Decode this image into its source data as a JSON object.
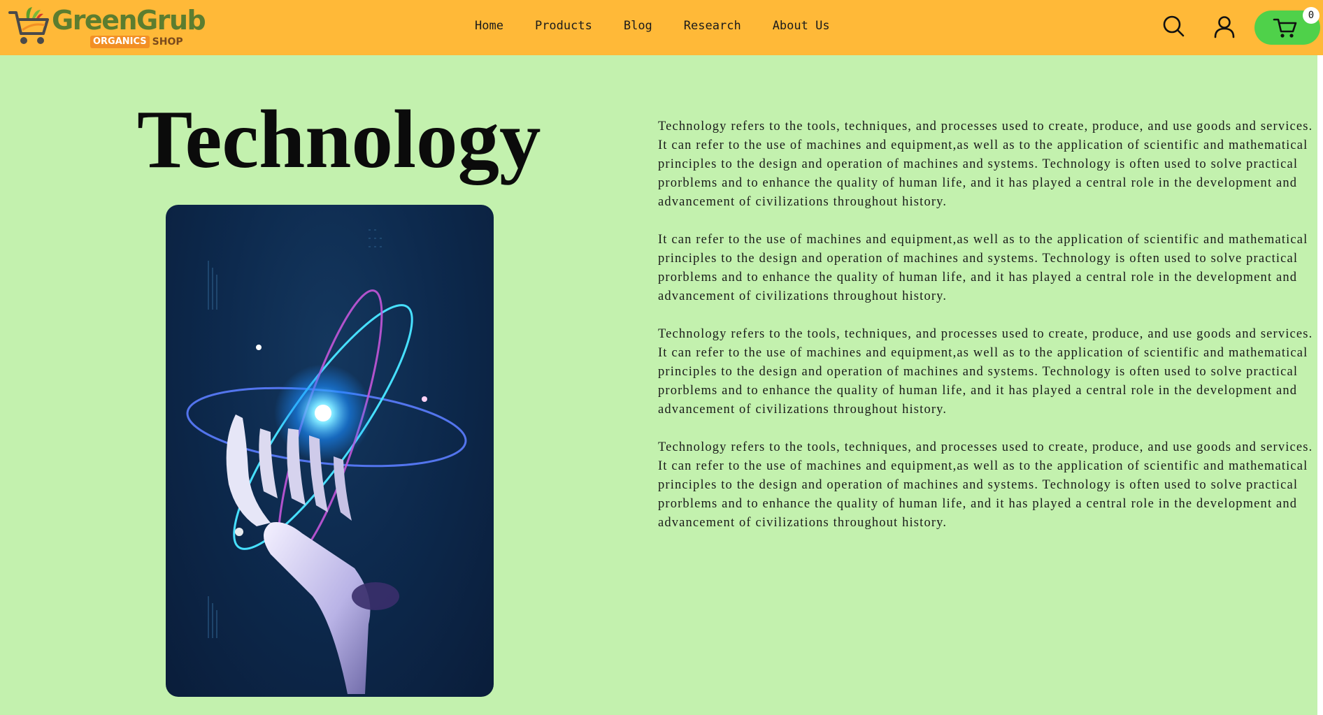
{
  "brand": {
    "name_part1": "Green",
    "name_part2": "Grub",
    "tag_organics": "ORGANICS",
    "tag_shop": "SHOP"
  },
  "nav": {
    "items": [
      {
        "label": "Home"
      },
      {
        "label": "Products"
      },
      {
        "label": "Blog"
      },
      {
        "label": "Research"
      },
      {
        "label": "About Us"
      }
    ]
  },
  "header_icons": {
    "search": "search-icon",
    "account": "user-icon",
    "cart": "cart-icon"
  },
  "cart": {
    "count": "0"
  },
  "page": {
    "title": "Technology"
  },
  "hero_image": {
    "subject": "robot-hand-atom-icon"
  },
  "article": {
    "paragraphs": [
      "Technology refers to the tools, techniques, and processes used to create, produce, and use goods and services. It can refer to the use of machines and equipment,as well as to the application of scientific and mathematical principles to the design and operation of machines and systems. Technology is often used to solve practical prorblems and to enhance the quality of human life, and it has played a central role in the development and advancement of civilizations throughout history.",
      "It can refer to the use of machines and equipment,as well as to the application of scientific and mathematical principles to the design and operation of machines and systems. Technology is often used to solve practical prorblems and to enhance the quality of human life, and it has played a central role in the development and advancement of civilizations throughout history.",
      "Technology refers to the tools, techniques, and processes used to create, produce, and use goods and services. It can refer to the use of machines and equipment,as well as to the application of scientific and mathematical principles to the design and operation of machines and systems. Technology is often used to solve practical prorblems and to enhance the quality of human life, and it has played a central role in the development and advancement of civilizations throughout history.",
      "Technology refers to the tools, techniques, and processes used to create, produce, and use goods and services. It can refer to the use of machines and equipment,as well as to the application of scientific and mathematical principles to the design and operation of machines and systems. Technology is often used to solve practical prorblems and to enhance the quality of human life, and it has played a central role in the development and advancement of civilizations throughout history."
    ]
  },
  "colors": {
    "header_bg": "#ffb938",
    "page_bg": "#c3f1ae",
    "cart_button": "#4fd14a",
    "brand_green": "#5c7d2f",
    "organics_badge": "#f28f24"
  }
}
